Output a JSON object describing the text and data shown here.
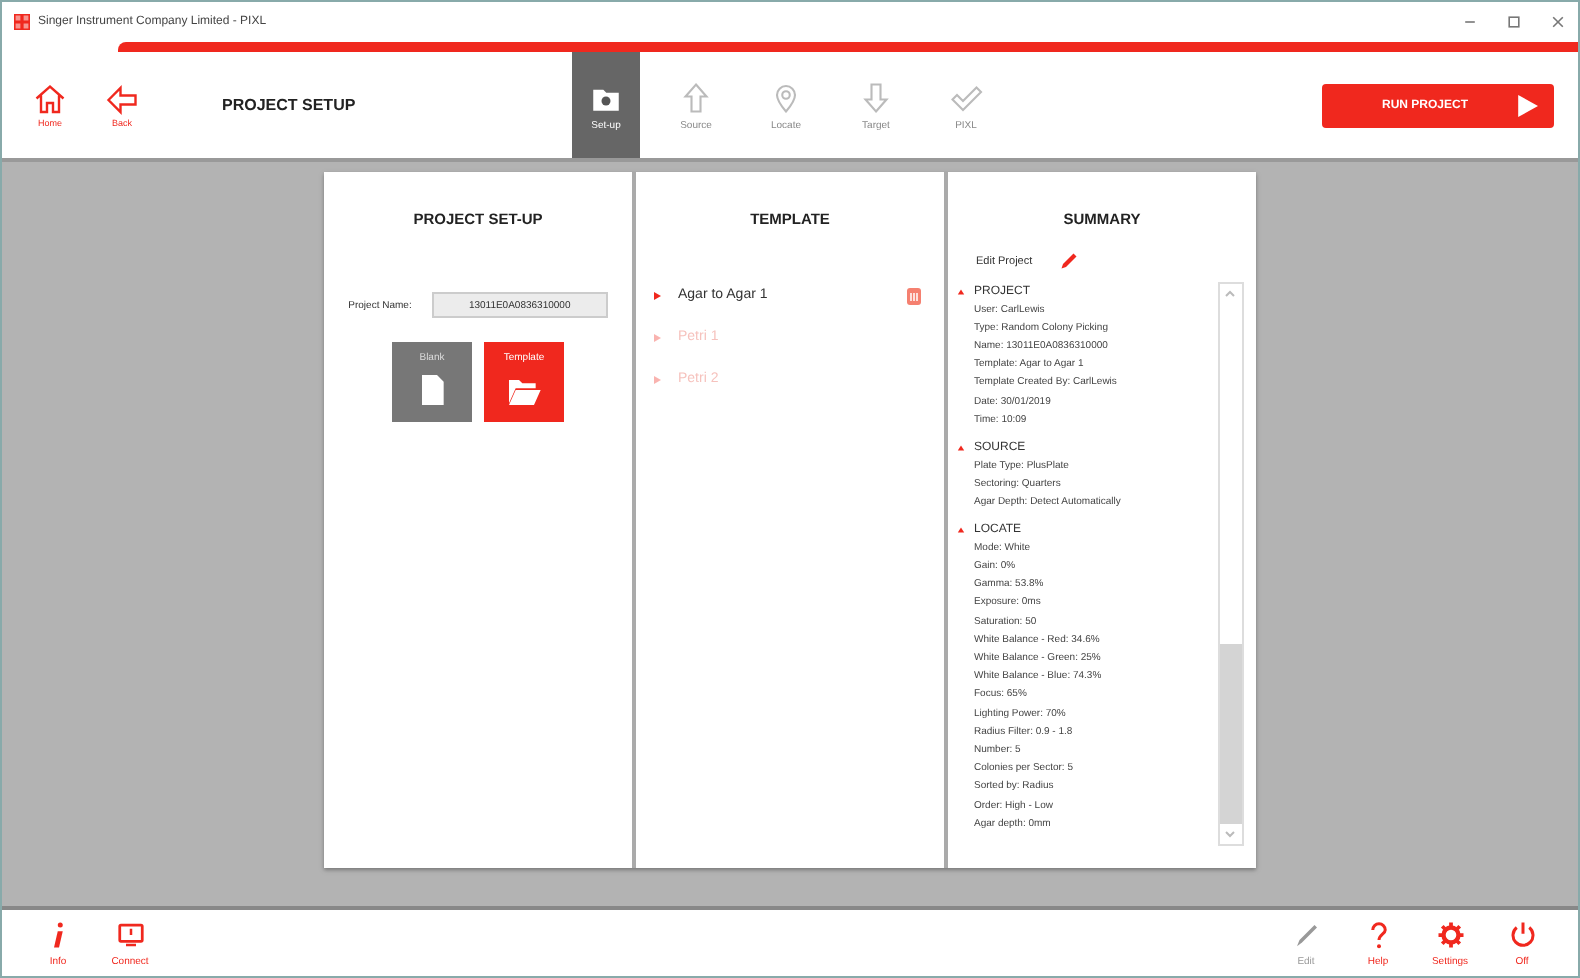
{
  "window": {
    "title": "Singer Instrument Company Limited - PIXL"
  },
  "header": {
    "nav": [
      {
        "kind": "home",
        "label": "Home"
      },
      {
        "kind": "back",
        "label": "Back"
      }
    ],
    "title": "PROJECT SETUP",
    "steps": [
      {
        "kind": "setup",
        "label": "Set-up",
        "selected": true
      },
      {
        "kind": "source",
        "label": "Source",
        "selected": false
      },
      {
        "kind": "locate",
        "label": "Locate",
        "selected": false
      },
      {
        "kind": "target",
        "label": "Target",
        "selected": false
      },
      {
        "kind": "pixl",
        "label": "PIXL",
        "selected": false
      }
    ],
    "run_button": "RUN PROJECT"
  },
  "setup_panel": {
    "title": "PROJECT SET-UP",
    "project_name_label": "Project Name:",
    "project_name": "13011E0A0836310000",
    "sources": [
      {
        "kind": "blank",
        "label": "Blank",
        "selected": false
      },
      {
        "kind": "template",
        "label": "Template",
        "selected": true
      }
    ]
  },
  "template_panel": {
    "title": "TEMPLATE",
    "items": [
      {
        "label": "Agar to Agar 1",
        "selected": true
      },
      {
        "label": "Petri 1",
        "selected": false
      },
      {
        "label": "Petri 2",
        "selected": false
      }
    ]
  },
  "summary_panel": {
    "title": "SUMMARY",
    "edit_label": "Edit Project",
    "sections": [
      {
        "title": "PROJECT",
        "lines": [
          "User:  CarlLewis",
          "Type:  Random Colony Picking",
          "Name:  13011E0A0836310000",
          "Template:  Agar to Agar 1",
          "Template Created By:  CarlLewis",
          "Date:  30/01/2019",
          "Time:  10:09"
        ]
      },
      {
        "title": "SOURCE",
        "lines": [
          "Plate Type:  PlusPlate",
          "Sectoring:  Quarters",
          "Agar Depth:  Detect Automatically"
        ]
      },
      {
        "title": "LOCATE",
        "lines": [
          "Mode:  White",
          "Gain:  0%",
          "Gamma:  53.8%",
          "Exposure:  0ms",
          "Saturation:  50",
          "White Balance - Red:  34.6%",
          "White Balance - Green:  25%",
          "White Balance - Blue:  74.3%",
          "Focus:  65%",
          "Lighting Power:  70%",
          "Radius Filter:  0.9 - 1.8",
          "Number:  5",
          "Colonies per Sector:  5",
          "Sorted by:  Radius",
          "Order:  High - Low",
          "Agar depth:  0mm"
        ]
      }
    ]
  },
  "footer": {
    "left": [
      {
        "kind": "info",
        "label": "Info",
        "disabled": false
      },
      {
        "kind": "connect",
        "label": "Connect",
        "disabled": false
      }
    ],
    "right": [
      {
        "kind": "edit",
        "label": "Edit",
        "disabled": true
      },
      {
        "kind": "help",
        "label": "Help",
        "disabled": false
      },
      {
        "kind": "settings",
        "label": "Settings",
        "disabled": false
      },
      {
        "kind": "off",
        "label": "Off",
        "disabled": false
      }
    ]
  }
}
